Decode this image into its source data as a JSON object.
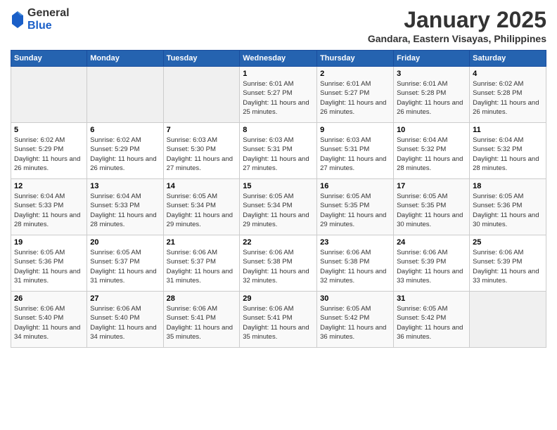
{
  "header": {
    "logo_general": "General",
    "logo_blue": "Blue",
    "month_title": "January 2025",
    "location": "Gandara, Eastern Visayas, Philippines"
  },
  "weekdays": [
    "Sunday",
    "Monday",
    "Tuesday",
    "Wednesday",
    "Thursday",
    "Friday",
    "Saturday"
  ],
  "weeks": [
    [
      {
        "day": "",
        "info": ""
      },
      {
        "day": "",
        "info": ""
      },
      {
        "day": "",
        "info": ""
      },
      {
        "day": "1",
        "info": "Sunrise: 6:01 AM\nSunset: 5:27 PM\nDaylight: 11 hours and 25 minutes."
      },
      {
        "day": "2",
        "info": "Sunrise: 6:01 AM\nSunset: 5:27 PM\nDaylight: 11 hours and 26 minutes."
      },
      {
        "day": "3",
        "info": "Sunrise: 6:01 AM\nSunset: 5:28 PM\nDaylight: 11 hours and 26 minutes."
      },
      {
        "day": "4",
        "info": "Sunrise: 6:02 AM\nSunset: 5:28 PM\nDaylight: 11 hours and 26 minutes."
      }
    ],
    [
      {
        "day": "5",
        "info": "Sunrise: 6:02 AM\nSunset: 5:29 PM\nDaylight: 11 hours and 26 minutes."
      },
      {
        "day": "6",
        "info": "Sunrise: 6:02 AM\nSunset: 5:29 PM\nDaylight: 11 hours and 26 minutes."
      },
      {
        "day": "7",
        "info": "Sunrise: 6:03 AM\nSunset: 5:30 PM\nDaylight: 11 hours and 27 minutes."
      },
      {
        "day": "8",
        "info": "Sunrise: 6:03 AM\nSunset: 5:31 PM\nDaylight: 11 hours and 27 minutes."
      },
      {
        "day": "9",
        "info": "Sunrise: 6:03 AM\nSunset: 5:31 PM\nDaylight: 11 hours and 27 minutes."
      },
      {
        "day": "10",
        "info": "Sunrise: 6:04 AM\nSunset: 5:32 PM\nDaylight: 11 hours and 28 minutes."
      },
      {
        "day": "11",
        "info": "Sunrise: 6:04 AM\nSunset: 5:32 PM\nDaylight: 11 hours and 28 minutes."
      }
    ],
    [
      {
        "day": "12",
        "info": "Sunrise: 6:04 AM\nSunset: 5:33 PM\nDaylight: 11 hours and 28 minutes."
      },
      {
        "day": "13",
        "info": "Sunrise: 6:04 AM\nSunset: 5:33 PM\nDaylight: 11 hours and 28 minutes."
      },
      {
        "day": "14",
        "info": "Sunrise: 6:05 AM\nSunset: 5:34 PM\nDaylight: 11 hours and 29 minutes."
      },
      {
        "day": "15",
        "info": "Sunrise: 6:05 AM\nSunset: 5:34 PM\nDaylight: 11 hours and 29 minutes."
      },
      {
        "day": "16",
        "info": "Sunrise: 6:05 AM\nSunset: 5:35 PM\nDaylight: 11 hours and 29 minutes."
      },
      {
        "day": "17",
        "info": "Sunrise: 6:05 AM\nSunset: 5:35 PM\nDaylight: 11 hours and 30 minutes."
      },
      {
        "day": "18",
        "info": "Sunrise: 6:05 AM\nSunset: 5:36 PM\nDaylight: 11 hours and 30 minutes."
      }
    ],
    [
      {
        "day": "19",
        "info": "Sunrise: 6:05 AM\nSunset: 5:36 PM\nDaylight: 11 hours and 31 minutes."
      },
      {
        "day": "20",
        "info": "Sunrise: 6:05 AM\nSunset: 5:37 PM\nDaylight: 11 hours and 31 minutes."
      },
      {
        "day": "21",
        "info": "Sunrise: 6:06 AM\nSunset: 5:37 PM\nDaylight: 11 hours and 31 minutes."
      },
      {
        "day": "22",
        "info": "Sunrise: 6:06 AM\nSunset: 5:38 PM\nDaylight: 11 hours and 32 minutes."
      },
      {
        "day": "23",
        "info": "Sunrise: 6:06 AM\nSunset: 5:38 PM\nDaylight: 11 hours and 32 minutes."
      },
      {
        "day": "24",
        "info": "Sunrise: 6:06 AM\nSunset: 5:39 PM\nDaylight: 11 hours and 33 minutes."
      },
      {
        "day": "25",
        "info": "Sunrise: 6:06 AM\nSunset: 5:39 PM\nDaylight: 11 hours and 33 minutes."
      }
    ],
    [
      {
        "day": "26",
        "info": "Sunrise: 6:06 AM\nSunset: 5:40 PM\nDaylight: 11 hours and 34 minutes."
      },
      {
        "day": "27",
        "info": "Sunrise: 6:06 AM\nSunset: 5:40 PM\nDaylight: 11 hours and 34 minutes."
      },
      {
        "day": "28",
        "info": "Sunrise: 6:06 AM\nSunset: 5:41 PM\nDaylight: 11 hours and 35 minutes."
      },
      {
        "day": "29",
        "info": "Sunrise: 6:06 AM\nSunset: 5:41 PM\nDaylight: 11 hours and 35 minutes."
      },
      {
        "day": "30",
        "info": "Sunrise: 6:05 AM\nSunset: 5:42 PM\nDaylight: 11 hours and 36 minutes."
      },
      {
        "day": "31",
        "info": "Sunrise: 6:05 AM\nSunset: 5:42 PM\nDaylight: 11 hours and 36 minutes."
      },
      {
        "day": "",
        "info": ""
      }
    ]
  ]
}
